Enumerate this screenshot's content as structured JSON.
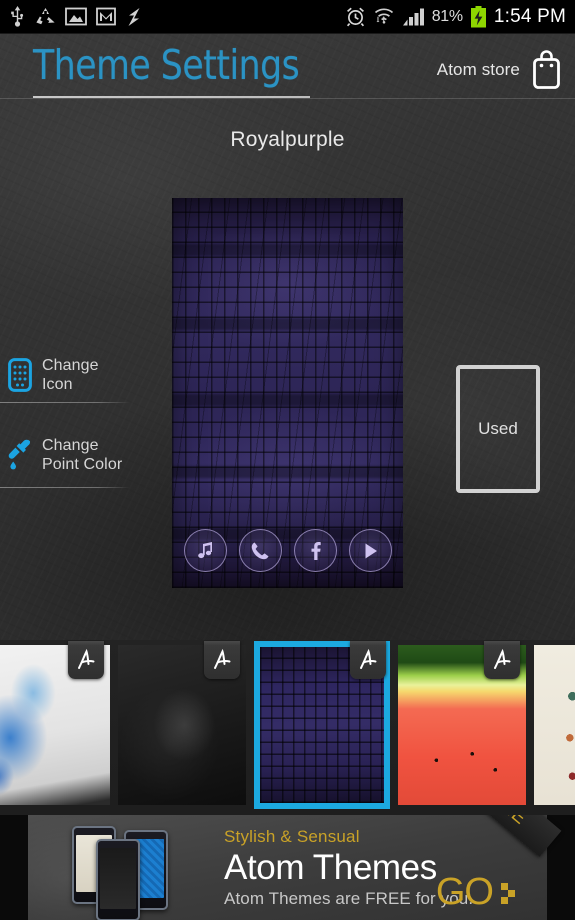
{
  "statusbar": {
    "left_icons": [
      "usb-icon",
      "sync-recycle-icon",
      "screenshot-image-icon",
      "gmail-icon",
      "data-transfer-icon"
    ],
    "right_icons": [
      "alarm-clock-icon",
      "wifi-icon",
      "signal-bars-icon",
      "battery-charging-icon"
    ],
    "battery_percent": "81%",
    "clock": "1:54 PM"
  },
  "header": {
    "app_title": "Theme Settings",
    "store_label": "Atom store",
    "store_icon": "shopping-bag-icon",
    "accent_color": "#2b93c4"
  },
  "theme": {
    "name": "Royalpurple",
    "preview_dock_icons": [
      "music-note-icon",
      "phone-icon",
      "facebook-icon",
      "play-icon"
    ]
  },
  "menu": {
    "items": [
      {
        "label_line1": "Change",
        "label_line2": "Icon",
        "icon": "phone-grid-icon"
      },
      {
        "label_line1": "Change",
        "label_line2": "Point Color",
        "icon": "eyedropper-icon"
      }
    ]
  },
  "used": {
    "label": "Used"
  },
  "thumbnails": {
    "selected_index": 2,
    "selected_border_color": "#1ca9e0",
    "items": [
      {
        "name": "ink-splash-theme",
        "art": "art-ink",
        "badge": "atom-logo-icon",
        "selected": false
      },
      {
        "name": "black-dust-theme",
        "art": "art-black",
        "badge": "atom-logo-icon",
        "selected": false
      },
      {
        "name": "royalpurple-theme",
        "art": "art-croc",
        "badge": "atom-logo-icon",
        "selected": true
      },
      {
        "name": "watermelon-theme",
        "art": "art-melon",
        "badge": "atom-logo-icon",
        "selected": false
      },
      {
        "name": "flatlay-items-theme",
        "art": "art-flat",
        "badge": "atom-logo-icon",
        "selected": false
      }
    ]
  },
  "ad": {
    "kicker": "Stylish & Sensual",
    "title": "Atom Themes",
    "subtitle": "Atom Themes are FREE for you.",
    "cta": "GO",
    "ribbon": "FREE",
    "gold_color": "#c9a227"
  }
}
